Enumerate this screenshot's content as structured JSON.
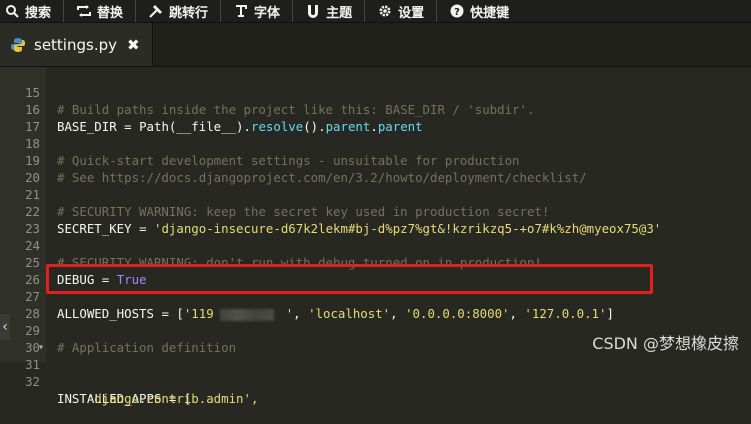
{
  "toolbar": {
    "items": [
      {
        "label": "搜索",
        "icon": "search-icon"
      },
      {
        "label": "替换",
        "icon": "replace-icon"
      },
      {
        "label": "跳转行",
        "icon": "goto-line-icon"
      },
      {
        "label": "字体",
        "icon": "font-icon"
      },
      {
        "label": "主题",
        "icon": "theme-icon"
      },
      {
        "label": "设置",
        "icon": "gear-icon"
      },
      {
        "label": "快捷键",
        "icon": "help-icon"
      }
    ]
  },
  "tab": {
    "title": "settings.py",
    "close": "✖",
    "icon": "python-icon"
  },
  "editor": {
    "colors": {
      "background": "#272822",
      "comment": "#75715e",
      "string": "#e6db74",
      "keyword": "#66d9ef",
      "constant": "#ae81ff",
      "highlight_border": "#e22020"
    },
    "lines": [
      {
        "num": "15",
        "comment": "# Build paths inside the project like this: BASE_DIR / 'subdir'."
      },
      {
        "num": "16",
        "name": "BASE_DIR",
        "eq": " = ",
        "call": "Path(__file__).",
        "a1": "resolve",
        "mid": "().",
        "a2": "parent",
        "dot": ".",
        "a3": "parent"
      },
      {
        "num": "17"
      },
      {
        "num": "18",
        "comment": "# Quick-start development settings - unsuitable for production"
      },
      {
        "num": "19",
        "comment": "# See https://docs.djangoproject.com/en/3.2/howto/deployment/checklist/"
      },
      {
        "num": "20"
      },
      {
        "num": "21",
        "comment": "# SECURITY WARNING: keep the secret key used in production secret!"
      },
      {
        "num": "22",
        "name": "SECRET_KEY",
        "eq": " = ",
        "str": "'django-insecure-d67k2lekm#bj-d%pz7%gt&!kzrikzq5-+o7#k%zh@myeox75@3'"
      },
      {
        "num": "23"
      },
      {
        "num": "24",
        "comment": "# SECURITY WARNING: don't run with debug turned on in production!"
      },
      {
        "num": "25",
        "name": "DEBUG",
        "eq": " = ",
        "const": "True"
      },
      {
        "num": "26"
      },
      {
        "num": "27",
        "name": "ALLOWED_HOSTS",
        "eq": " = ",
        "open": "[",
        "s1": "'119",
        "s1end": "'",
        "comma1": ", ",
        "s2": "'localhost'",
        "comma2": ", ",
        "s3": "'0.0.0.0:8000'",
        "comma3": ", ",
        "s4": "'127.0.0.1'",
        "close": "]"
      },
      {
        "num": "28"
      },
      {
        "num": "29",
        "comment": "# Application definition"
      },
      {
        "num": "30"
      },
      {
        "num": "31",
        "name": "INSTALLED_APPS",
        "eq": " = ",
        "open": "["
      },
      {
        "num": "32",
        "str": "    'django.contrib.admin',"
      }
    ]
  },
  "watermark": "CSDN @梦想橡皮擦"
}
